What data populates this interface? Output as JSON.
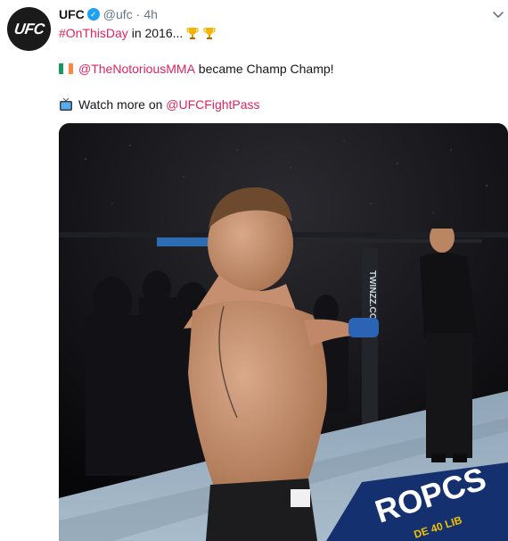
{
  "tweet": {
    "author_name": "UFC",
    "avatar_text": "UFC",
    "verified_mark": "✓",
    "handle": "@ufc",
    "separator": "·",
    "time": "4h",
    "line1": {
      "hashtag": "#OnThisDay",
      "text": " in 2016..."
    },
    "line2": {
      "mention": "@TheNotoriousMMA",
      "text": " became Champ Champ!"
    },
    "line3": {
      "text": "Watch more on ",
      "mention": "@UFCFightPass"
    },
    "icons": {
      "trophy": "trophy-icon",
      "flag": "ireland-flag-icon",
      "tv": "television-icon",
      "menu": "chevron-down-icon"
    },
    "colors": {
      "link": "#e0245e",
      "verified": "#1da1f2",
      "secondary_text": "#657786"
    }
  },
  "media": {
    "type": "animated-gif",
    "cage_text": "TWINZZ.COM",
    "banner_text": "ROPCS",
    "mat_text": "DE 40 LIB"
  }
}
